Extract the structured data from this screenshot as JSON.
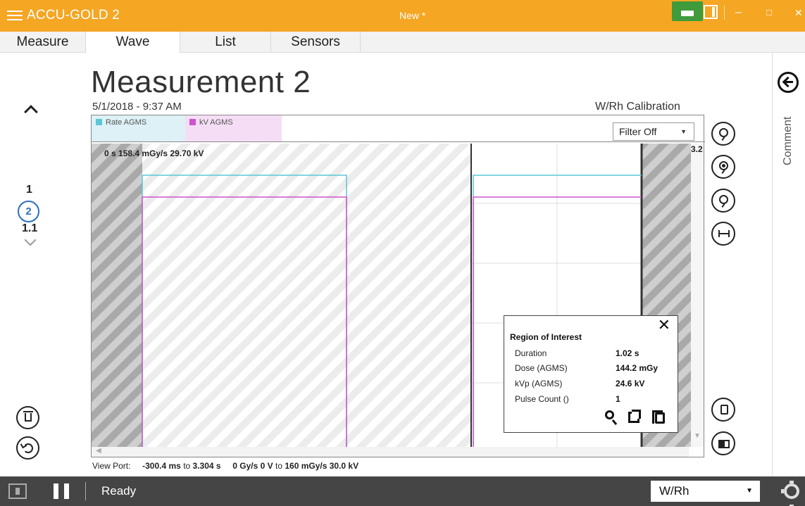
{
  "titlebar": {
    "app_title": "ACCU-GOLD 2",
    "doc_title": "New *",
    "minimize": "–",
    "maximize": "□",
    "close": "✕"
  },
  "tabs": [
    {
      "label": "Measure",
      "active": false
    },
    {
      "label": "Wave",
      "active": true
    },
    {
      "label": "List",
      "active": false
    },
    {
      "label": "Sensors",
      "active": false
    }
  ],
  "measurement_nav": {
    "items": [
      "1",
      "1.1"
    ],
    "current": "2"
  },
  "header": {
    "title": "Measurement 2",
    "timestamp": "5/1/2018 - 9:37 AM",
    "calibration": "W/Rh Calibration"
  },
  "legend": [
    {
      "name": "Rate AGMS",
      "color": "#5bc7d6",
      "bg": "#ddf1f6"
    },
    {
      "name": "kV AGMS",
      "color": "#cc55cc",
      "bg": "#f5def5"
    }
  ],
  "filter": {
    "value": "Filter Off",
    "arrow": "▼"
  },
  "cursor_readout": "0 s 158.4 mGy/s 29.70 kV",
  "right_edge_readout": "3.2",
  "roi": {
    "title": "Region of Interest",
    "close": "✕",
    "rows": [
      {
        "label": "Duration",
        "value": "1.02 s"
      },
      {
        "label": "Dose (AGMS)",
        "value": "144.2 mGy"
      },
      {
        "label": "kVp (AGMS)",
        "value": "24.6 kV"
      },
      {
        "label": "Pulse Count ()",
        "value": "1"
      }
    ]
  },
  "viewport": {
    "label": "View Port:",
    "x_from": "-300.4 ms",
    "x_to_word": "to",
    "x_to": "3.304 s",
    "y_from": "0 Gy/s 0 V",
    "y_to_word": "to",
    "y_to": "160 mGy/s  30.0 kV"
  },
  "comment_label": "Comment",
  "status": {
    "text": "Ready",
    "units": "W/Rh",
    "units_arrow": "▼"
  }
}
